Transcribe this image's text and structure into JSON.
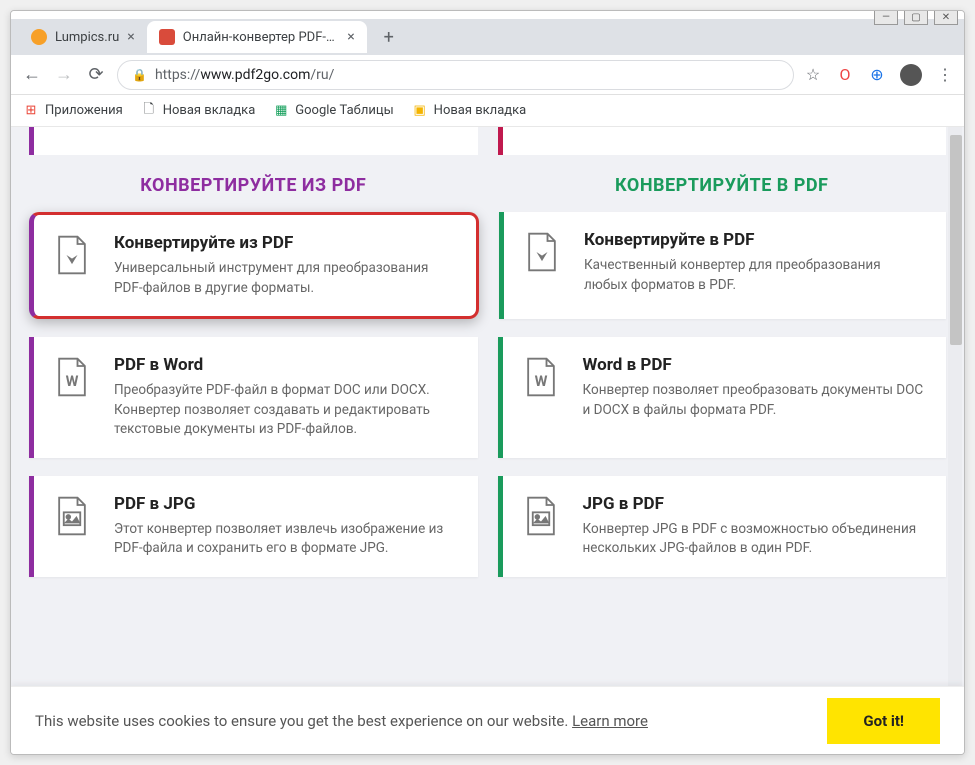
{
  "window": {
    "min": "—",
    "max": "▢",
    "close": "✕"
  },
  "tabs": [
    {
      "title": "Lumpics.ru",
      "favicon": "#f7a028",
      "active": false
    },
    {
      "title": "Онлайн-конвертер PDF-файлов",
      "favicon": "#d94b3b",
      "active": true
    }
  ],
  "newtab": "+",
  "nav": {
    "back": "←",
    "forward": "→",
    "reload": "⟳"
  },
  "url": {
    "lock": "🔒",
    "proto": "https://",
    "host": "www.pdf2go.com",
    "path": "/ru/"
  },
  "toolbar_icons": {
    "star": "☆",
    "opera": "O",
    "globe": "⊕",
    "menu": "⋮"
  },
  "bookmarks": [
    {
      "icon": "⊞",
      "label": "Приложения",
      "color": "#1a73e8"
    },
    {
      "icon": "🗋",
      "label": "Новая вкладка",
      "color": "#5f6368"
    },
    {
      "icon": "▦",
      "label": "Google Таблицы",
      "color": "#0f9d58"
    },
    {
      "icon": "▣",
      "label": "Новая вкладка",
      "color": "#f4b400"
    }
  ],
  "stub_colors": {
    "left": "#8e2da0",
    "right": "#c0194e"
  },
  "headings": {
    "left": "КОНВЕРТИРУЙТЕ ИЗ PDF",
    "right": "КОНВЕРТИРУЙТЕ В PDF"
  },
  "cards_left": [
    {
      "icon": "pdf",
      "title": "Конвертируйте из PDF",
      "desc": "Универсальный инструмент для преобразования PDF-файлов в другие форматы.",
      "highlighted": true
    },
    {
      "icon": "word",
      "title": "PDF в Word",
      "desc": "Преобразуйте PDF-файл в формат DOC или DOCX. Конвертер позволяет создавать и редактировать текстовые документы из PDF-файлов.",
      "highlighted": false
    },
    {
      "icon": "image",
      "title": "PDF в JPG",
      "desc": "Этот конвертер позволяет извлечь изображение из PDF-файла и сохранить его в формате JPG.",
      "highlighted": false
    }
  ],
  "cards_right": [
    {
      "icon": "pdf",
      "title": "Конвертируйте в PDF",
      "desc": "Качественный конвертер для преобразования любых форматов в PDF.",
      "highlighted": false
    },
    {
      "icon": "word",
      "title": "Word в PDF",
      "desc": "Конвертер позволяет преобразовать документы DOC и DOCX в файлы формата PDF.",
      "highlighted": false
    },
    {
      "icon": "image",
      "title": "JPG в PDF",
      "desc": "Конвертер JPG в PDF с возможностью объединения нескольких JPG-файлов в один PDF.",
      "highlighted": false
    }
  ],
  "cookie": {
    "msg": "This website uses cookies to ensure you get the best experience on our website.  ",
    "learn": "Learn more",
    "btn": "Got it!"
  }
}
